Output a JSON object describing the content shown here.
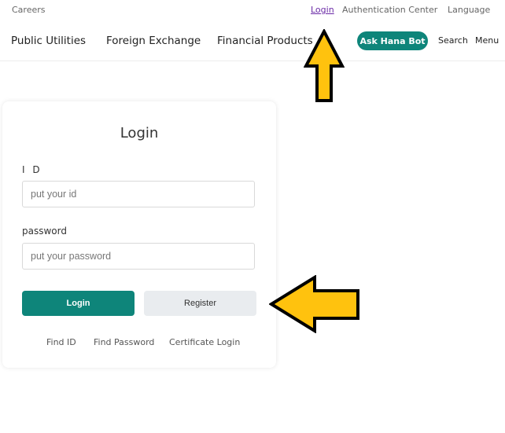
{
  "top_bar": {
    "careers": "Careers",
    "login": "Login",
    "authentication_center": "Authentication Center",
    "language": "Language"
  },
  "nav": {
    "public_utilities": "Public Utilities",
    "foreign_exchange": "Foreign Exchange",
    "financial_products": "Financial Products",
    "ask_hana_bot": "Ask Hana Bot",
    "search": "Search",
    "menu": "Menu"
  },
  "login_card": {
    "title": "Login",
    "id_label": "I D",
    "id_placeholder": "put your id",
    "password_label": "password",
    "password_placeholder": "put your password",
    "login_button": "Login",
    "register_button": "Register",
    "find_id": "Find ID",
    "find_password": "Find Password",
    "certificate_login": "Certificate Login"
  },
  "colors": {
    "brand_teal": "#0e857a",
    "register_bg": "#e9ecef",
    "arrow_fill": "#ffc20e",
    "arrow_outline": "#000000",
    "visited_link": "#6a2aa6"
  },
  "annotations": {
    "arrow_up_icon": "arrow-up-icon",
    "arrow_left_icon": "arrow-left-icon"
  }
}
